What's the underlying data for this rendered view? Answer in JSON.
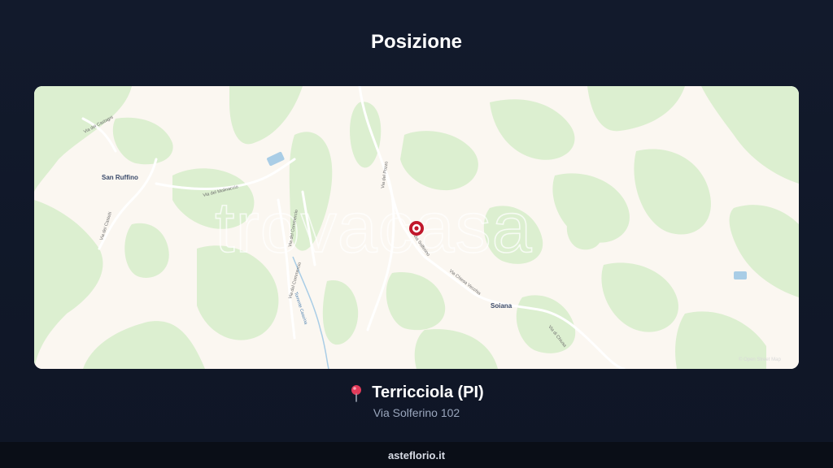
{
  "header": {
    "title": "Posizione"
  },
  "map": {
    "watermark": "trovacasa",
    "places": {
      "san_ruffino": "San Ruffino",
      "soiana": "Soiana"
    },
    "roads": {
      "via_dei_castagni": "Via dei Castagni",
      "via_del_molinaccio": "Via del Molinaccio",
      "via_dei_castelli": "Via dei Castelli",
      "via_del_commercio_1": "Via del Commercio",
      "via_del_commercio_2": "Via del Commercio",
      "via_del_pozzo": "Via del Pozzo",
      "via_chiesa_vecchia": "Via Chiesa Vecchia",
      "via_di_chiusa": "Via di Chiusa",
      "via_solferino": "Via Solferino"
    },
    "water": {
      "torrente": "Torrente Cascina"
    },
    "attribution": "© Open Street Map",
    "colors": {
      "land": "#fbf7f1",
      "green": "#dcefd0",
      "water": "#a9cde6",
      "marker": "#c0182b"
    }
  },
  "location": {
    "icon": "map-pin-icon",
    "city": "Terricciola (PI)",
    "address": "Via Solferino 102"
  },
  "footer": {
    "brand": "asteflorio.it"
  }
}
